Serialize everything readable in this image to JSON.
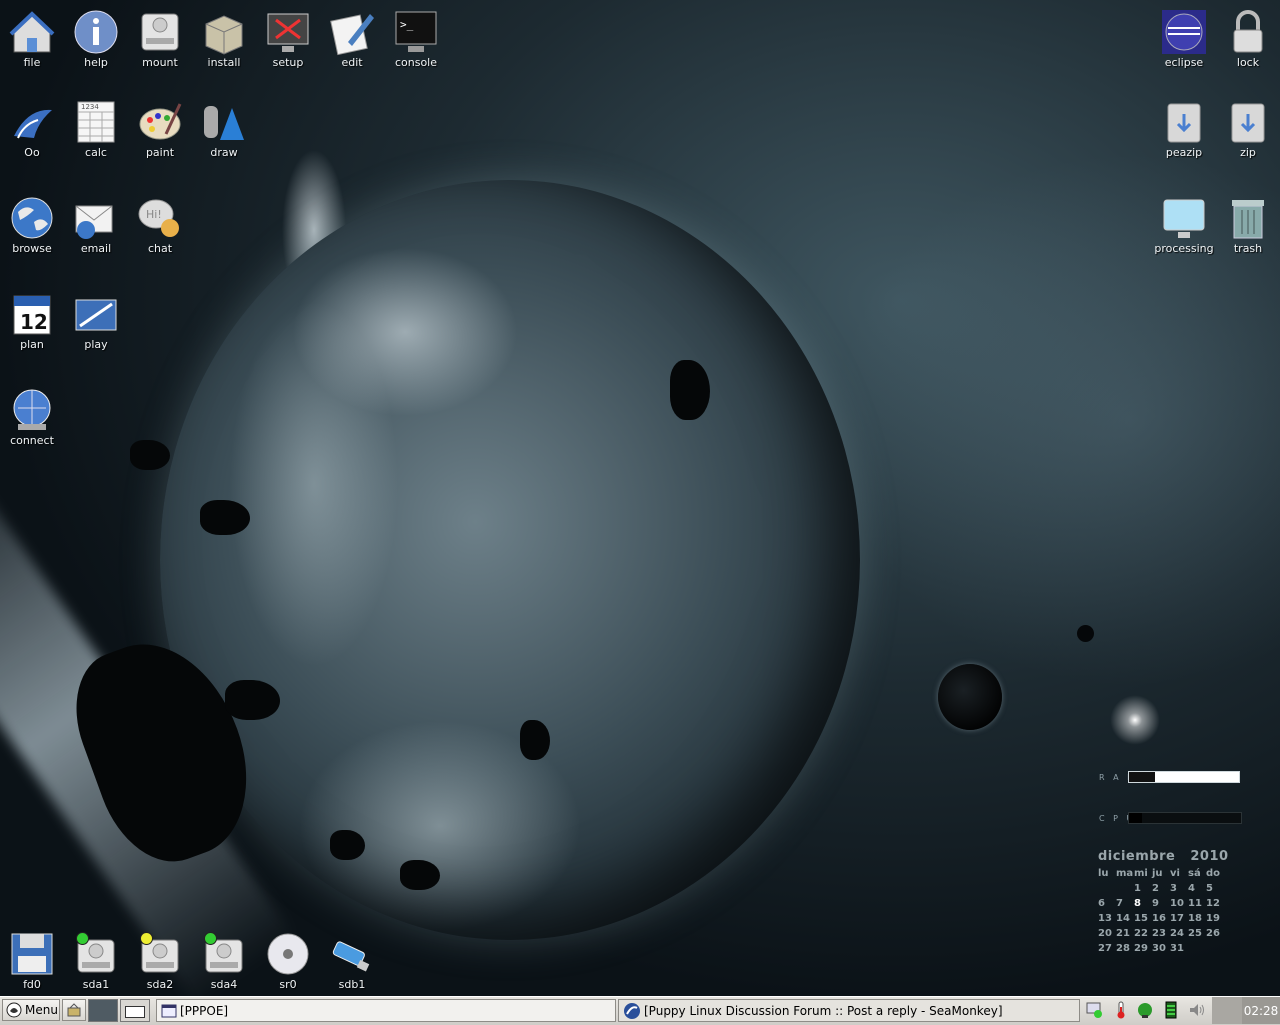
{
  "desktop_icons_left": [
    {
      "label": "file",
      "icon": "home-folder-icon"
    },
    {
      "label": "help",
      "icon": "info-icon"
    },
    {
      "label": "mount",
      "icon": "drive-icon"
    },
    {
      "label": "install",
      "icon": "package-box-icon"
    },
    {
      "label": "setup",
      "icon": "monitor-tools-icon"
    },
    {
      "label": "edit",
      "icon": "pencil-paper-icon"
    },
    {
      "label": "console",
      "icon": "terminal-icon"
    },
    {
      "label": "Oo",
      "icon": "openoffice-icon"
    },
    {
      "label": "calc",
      "icon": "spreadsheet-icon"
    },
    {
      "label": "paint",
      "icon": "palette-icon"
    },
    {
      "label": "draw",
      "icon": "draw-shapes-icon"
    },
    {
      "label": "browse",
      "icon": "globe-icon"
    },
    {
      "label": "email",
      "icon": "envelope-icon"
    },
    {
      "label": "chat",
      "icon": "chat-bubble-icon"
    },
    {
      "label": "plan",
      "icon": "calendar-icon"
    },
    {
      "label": "play",
      "icon": "media-player-icon"
    },
    {
      "label": "connect",
      "icon": "network-globe-icon"
    }
  ],
  "desktop_icons_right": [
    {
      "label": "eclipse",
      "icon": "eclipse-icon"
    },
    {
      "label": "lock",
      "icon": "padlock-icon"
    },
    {
      "label": "peazip",
      "icon": "archive-icon"
    },
    {
      "label": "zip",
      "icon": "zip-archive-icon"
    },
    {
      "label": "processing",
      "icon": "computer-screen-icon"
    },
    {
      "label": "trash",
      "icon": "trash-can-icon"
    }
  ],
  "drive_icons": [
    {
      "label": "fd0",
      "icon": "floppy-icon"
    },
    {
      "label": "sda1",
      "icon": "hard-drive-icon"
    },
    {
      "label": "sda2",
      "icon": "hard-drive-icon"
    },
    {
      "label": "sda4",
      "icon": "hard-drive-icon"
    },
    {
      "label": "sr0",
      "icon": "cd-disc-icon"
    },
    {
      "label": "sdb1",
      "icon": "usb-stick-icon"
    }
  ],
  "sysmon": {
    "ram_label": "R A M",
    "cpu_label": "C P U",
    "ram_usage": 0.24,
    "cpu_usage": 0.12
  },
  "calendar": {
    "month": "diciembre",
    "year": "2010",
    "weekdays": [
      "lu",
      "ma",
      "mi",
      "ju",
      "vi",
      "sá",
      "do"
    ],
    "weeks": [
      [
        "",
        "",
        "1",
        "2",
        "3",
        "4",
        "5"
      ],
      [
        "6",
        "7",
        "8",
        "9",
        "10",
        "11",
        "12"
      ],
      [
        "13",
        "14",
        "15",
        "16",
        "17",
        "18",
        "19"
      ],
      [
        "20",
        "21",
        "22",
        "23",
        "24",
        "25",
        "26"
      ],
      [
        "27",
        "28",
        "29",
        "30",
        "31",
        "",
        ""
      ]
    ],
    "today": "8"
  },
  "taskbar": {
    "menu_label": "Menu",
    "tasks": [
      {
        "label": "[PPPOE]",
        "icon": "window-icon"
      },
      {
        "label": "[Puppy Linux Discussion Forum :: Post a reply - SeaMonkey]",
        "icon": "seamonkey-icon"
      }
    ],
    "clock": "02:28",
    "tray_icons": [
      "network-status-icon",
      "temperature-icon",
      "connection-icon",
      "battery-icon",
      "volume-icon"
    ]
  },
  "colors": {
    "taskbar_bg": "#dcdad5",
    "clock_bg": "#9a9893"
  }
}
